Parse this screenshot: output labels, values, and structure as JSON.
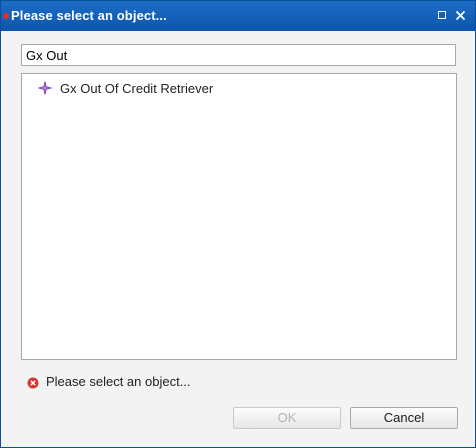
{
  "window": {
    "title": "Please select an object...",
    "controls": [
      "maximize-icon",
      "close-icon"
    ]
  },
  "filter": {
    "value": "Gx Out"
  },
  "results": [
    {
      "label": "Gx Out Of Credit Retriever",
      "icon": "object-sparkle-icon"
    }
  ],
  "status": {
    "icon": "error-icon",
    "message": "Please select an object..."
  },
  "buttons": {
    "ok_label": "OK",
    "ok_enabled": false,
    "cancel_label": "Cancel"
  },
  "colors": {
    "titlebar": "#0d55ad",
    "error": "#d9342b",
    "object_icon": "#9b59c7"
  }
}
